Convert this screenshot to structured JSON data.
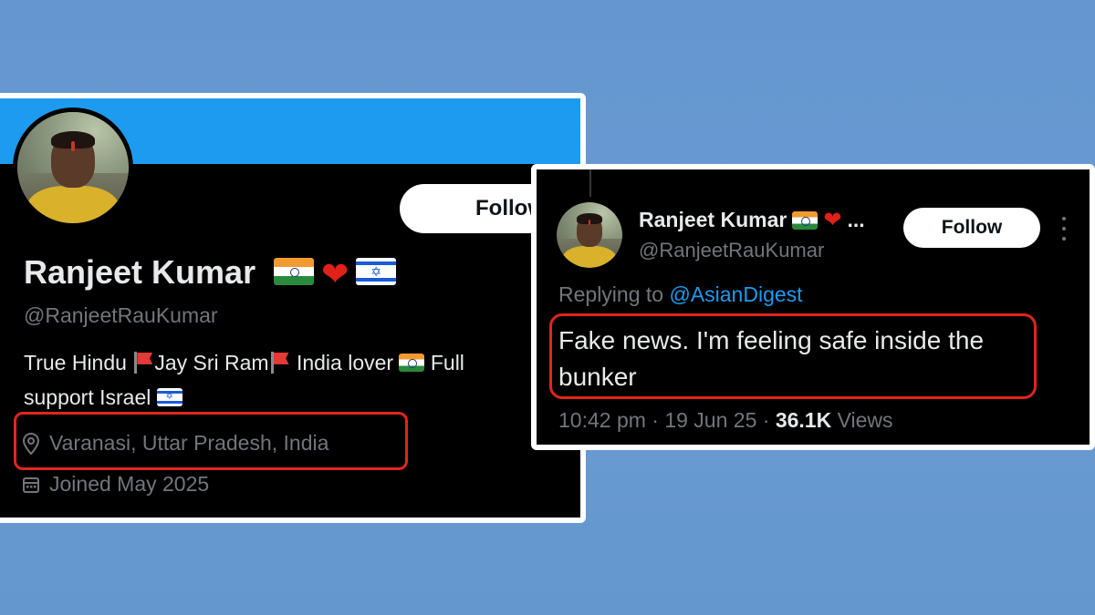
{
  "profile": {
    "name": "Ranjeet Kumar",
    "handle": "@RanjeetRauKumar",
    "follow_label": "Follow",
    "bio": {
      "part1": "True Hindu ",
      "part2": "Jay Sri Ram",
      "part3": " India lover ",
      "part4": " Full",
      "line2": "support Israel "
    },
    "location": "Varanasi, Uttar Pradesh, India",
    "joined": "Joined May 2025",
    "colors": {
      "banner": "#1d9bf0",
      "highlight": "#e0261b"
    }
  },
  "tweet": {
    "name": "Ranjeet Kumar",
    "name_truncation": "...",
    "handle": "@RanjeetRauKumar",
    "follow_label": "Follow",
    "replying_prefix": "Replying to ",
    "replying_to": "@AsianDigest",
    "text": "Fake news. I'm feeling safe inside the bunker",
    "time": "10:42 pm · 19 Jun 25 · ",
    "views_count": "36.1K",
    "views_label": " Views"
  },
  "icons": [
    "india-flag-icon",
    "red-heart-icon",
    "israel-flag-icon",
    "red-flag-icon",
    "location-pin-icon",
    "calendar-icon",
    "more-options-icon"
  ]
}
